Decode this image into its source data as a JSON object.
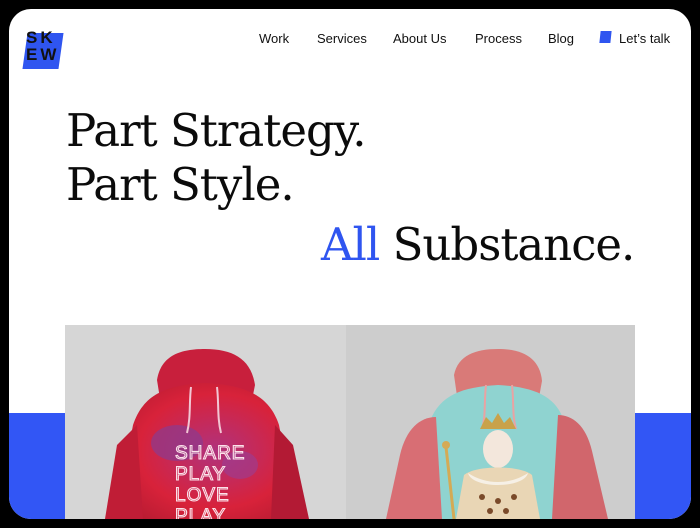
{
  "brand": {
    "logo_top": "SK",
    "logo_bottom": "EW"
  },
  "nav": {
    "items": [
      "Work",
      "Services",
      "About Us",
      "Process",
      "Blog"
    ],
    "cta": "Let’s talk"
  },
  "hero": {
    "line1": "Part Strategy.",
    "line2": "Part Style.",
    "line3_accent": "All",
    "line3_rest": "Substance."
  },
  "products": {
    "left_print": [
      "SHARE",
      "PLAY",
      "LOVE",
      "PLAY"
    ]
  },
  "colors": {
    "accent": "#2f55f0",
    "text": "#0b0b0b",
    "background": "#ffffff"
  }
}
